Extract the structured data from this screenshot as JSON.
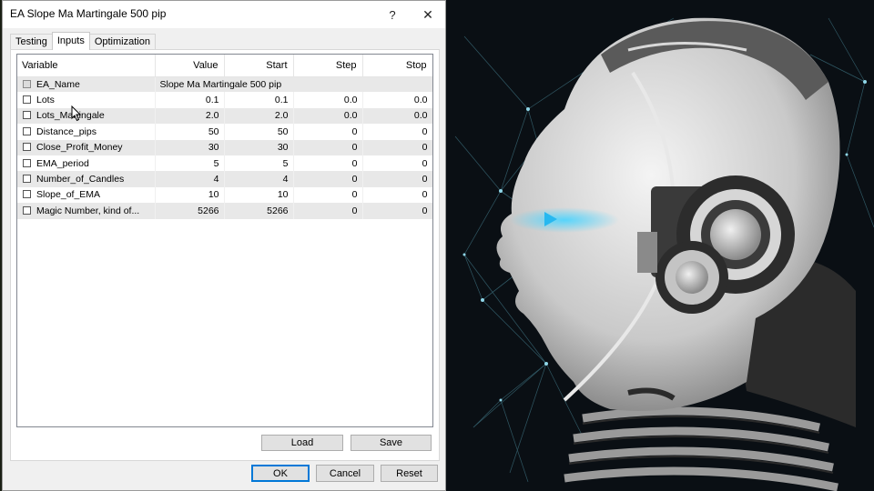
{
  "dialog": {
    "title": "EA Slope Ma Martingale 500 pip",
    "help_label": "?",
    "close_label": "✕"
  },
  "tabs": [
    {
      "label": "Testing",
      "active": false
    },
    {
      "label": "Inputs",
      "active": true
    },
    {
      "label": "Optimization",
      "active": false
    }
  ],
  "grid": {
    "columns": [
      "Variable",
      "Value",
      "Start",
      "Step",
      "Stop"
    ],
    "name_row": {
      "variable": "EA_Name",
      "value": "Slope Ma Martingale 500 pip"
    },
    "rows": [
      {
        "variable": "Lots",
        "value": "0.1",
        "start": "0.1",
        "step": "0.0",
        "stop": "0.0"
      },
      {
        "variable": "Lots_Martingale",
        "value": "2.0",
        "start": "2.0",
        "step": "0.0",
        "stop": "0.0"
      },
      {
        "variable": "Distance_pips",
        "value": "50",
        "start": "50",
        "step": "0",
        "stop": "0"
      },
      {
        "variable": "Close_Profit_Money",
        "value": "30",
        "start": "30",
        "step": "0",
        "stop": "0"
      },
      {
        "variable": "EMA_period",
        "value": "5",
        "start": "5",
        "step": "0",
        "stop": "0"
      },
      {
        "variable": "Number_of_Candles",
        "value": "4",
        "start": "4",
        "step": "0",
        "stop": "0"
      },
      {
        "variable": "Slope_of_EMA",
        "value": "10",
        "start": "10",
        "step": "0",
        "stop": "0"
      },
      {
        "variable": "Magic Number, kind of...",
        "value": "5266",
        "start": "5266",
        "step": "0",
        "stop": "0"
      }
    ]
  },
  "buttons": {
    "load": "Load",
    "save": "Save",
    "ok": "OK",
    "cancel": "Cancel",
    "reset": "Reset"
  },
  "colors": {
    "default_button_border": "#0078d7",
    "background_art": "#0a0f14"
  }
}
